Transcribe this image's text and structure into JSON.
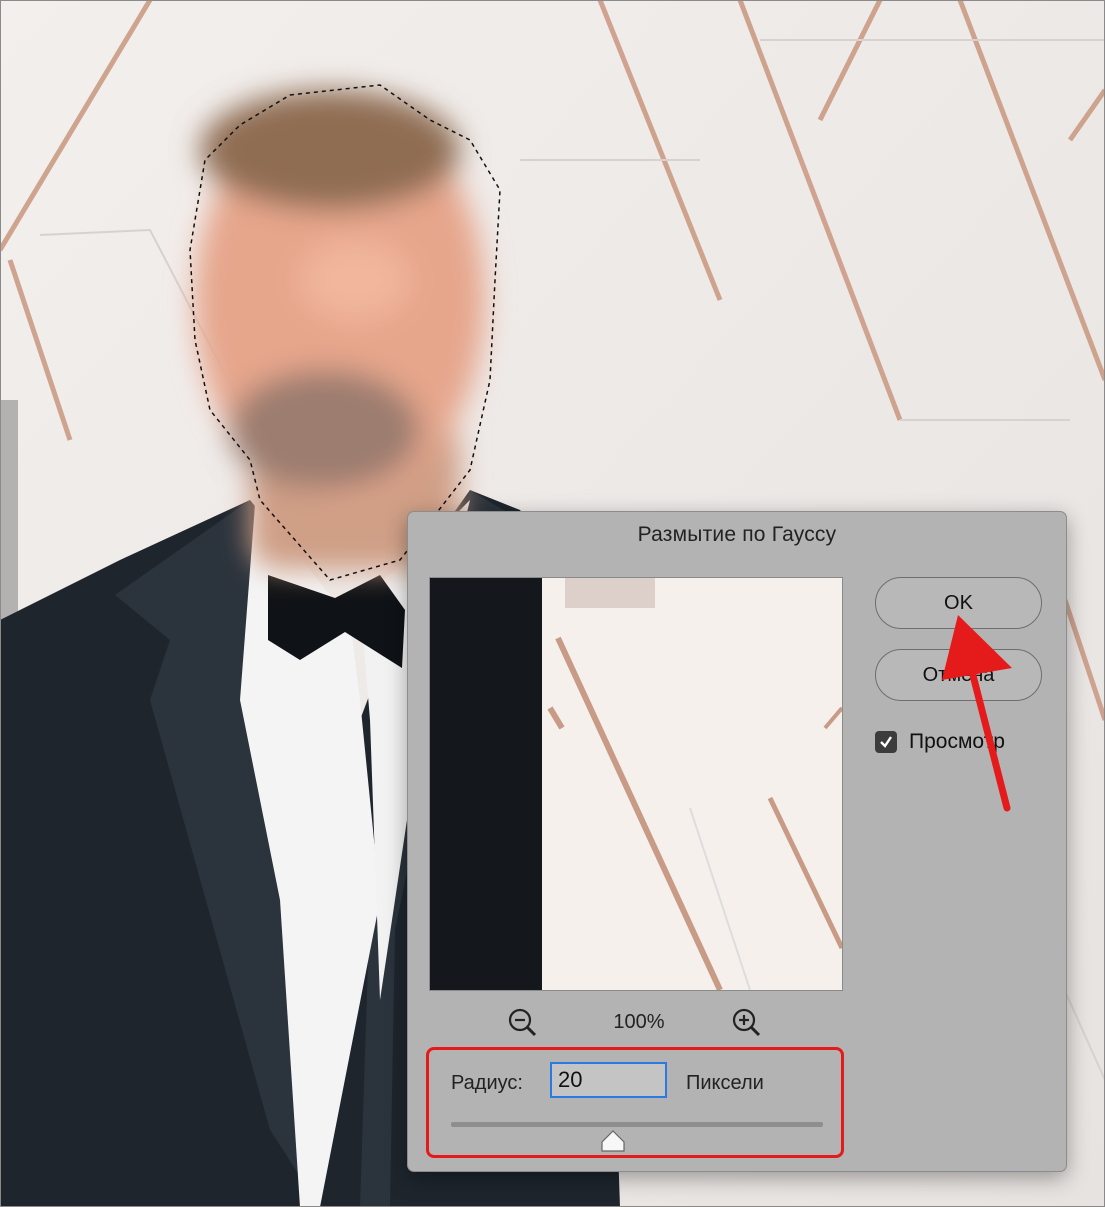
{
  "dialog": {
    "title": "Размытие по Гауссу",
    "ok_label": "OK",
    "cancel_label": "Отмена",
    "preview_checkbox": {
      "label": "Просмотр",
      "checked": true
    },
    "zoom": {
      "level": "100%",
      "zoom_out_icon": "zoom-out-icon",
      "zoom_in_icon": "zoom-in-icon"
    },
    "radius": {
      "label": "Радиус:",
      "value": "20",
      "units": "Пиксели"
    }
  },
  "annotations": {
    "highlight_color": "#e51b1b",
    "arrow_color": "#e51b1b"
  }
}
